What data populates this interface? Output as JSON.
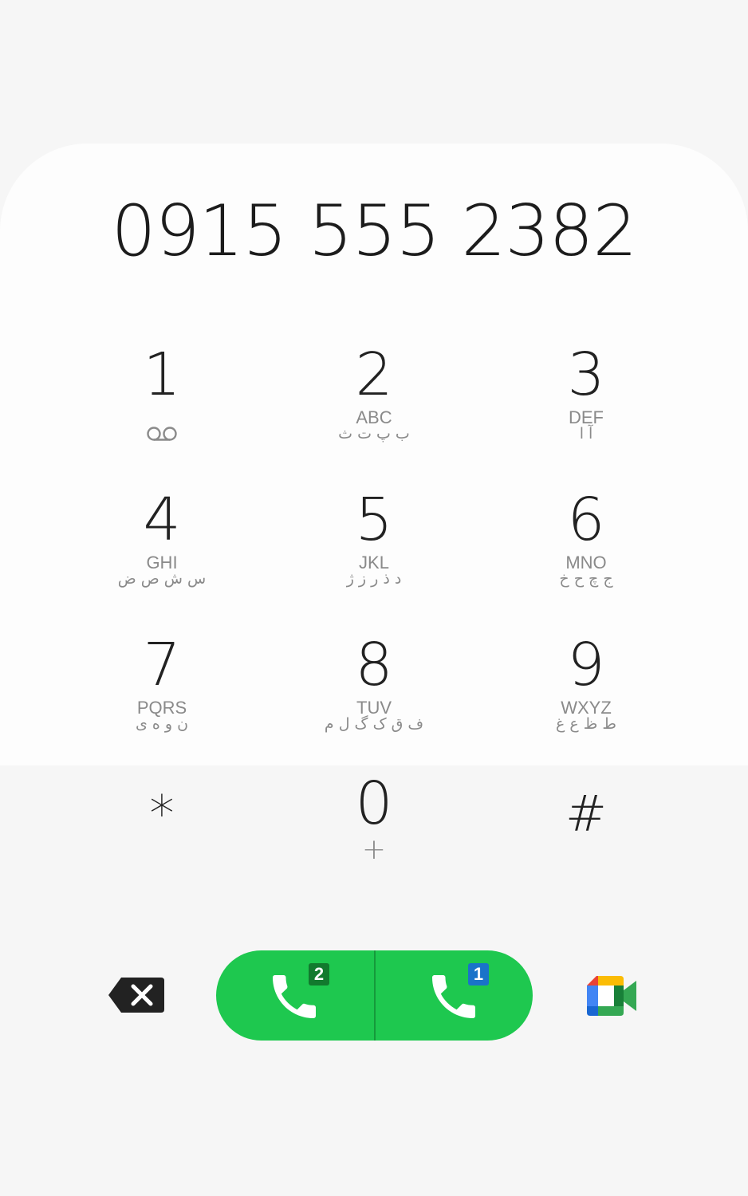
{
  "dialer": {
    "number": "0915 555 2382"
  },
  "keys": [
    {
      "digit": "1",
      "letters": "",
      "arabic": ""
    },
    {
      "digit": "2",
      "letters": "ABC",
      "arabic": "ب پ ت ث"
    },
    {
      "digit": "3",
      "letters": "DEF",
      "arabic": "آ ا"
    },
    {
      "digit": "4",
      "letters": "GHI",
      "arabic": "س ش ص ض"
    },
    {
      "digit": "5",
      "letters": "JKL",
      "arabic": "د ذ ر ز ژ"
    },
    {
      "digit": "6",
      "letters": "MNO",
      "arabic": "ج چ ح خ"
    },
    {
      "digit": "7",
      "letters": "PQRS",
      "arabic": "ن و ه ی"
    },
    {
      "digit": "8",
      "letters": "TUV",
      "arabic": "ف ق ک گ ل م"
    },
    {
      "digit": "9",
      "letters": "WXYZ",
      "arabic": "ط ظ ع غ"
    },
    {
      "digit": "*",
      "letters": "",
      "arabic": ""
    },
    {
      "digit": "0",
      "letters": "+",
      "arabic": ""
    },
    {
      "digit": "#",
      "letters": "",
      "arabic": ""
    }
  ],
  "call_buttons": {
    "sim2_label": "2",
    "sim1_label": "1"
  },
  "icons": {
    "backspace": "backspace-icon",
    "voicemail": "voicemail-icon",
    "phone": "phone-icon",
    "meet": "google-meet-icon"
  },
  "colors": {
    "call_green": "#1ec84f",
    "sim2_badge": "#127a2e",
    "sim1_badge": "#1a73c9"
  }
}
